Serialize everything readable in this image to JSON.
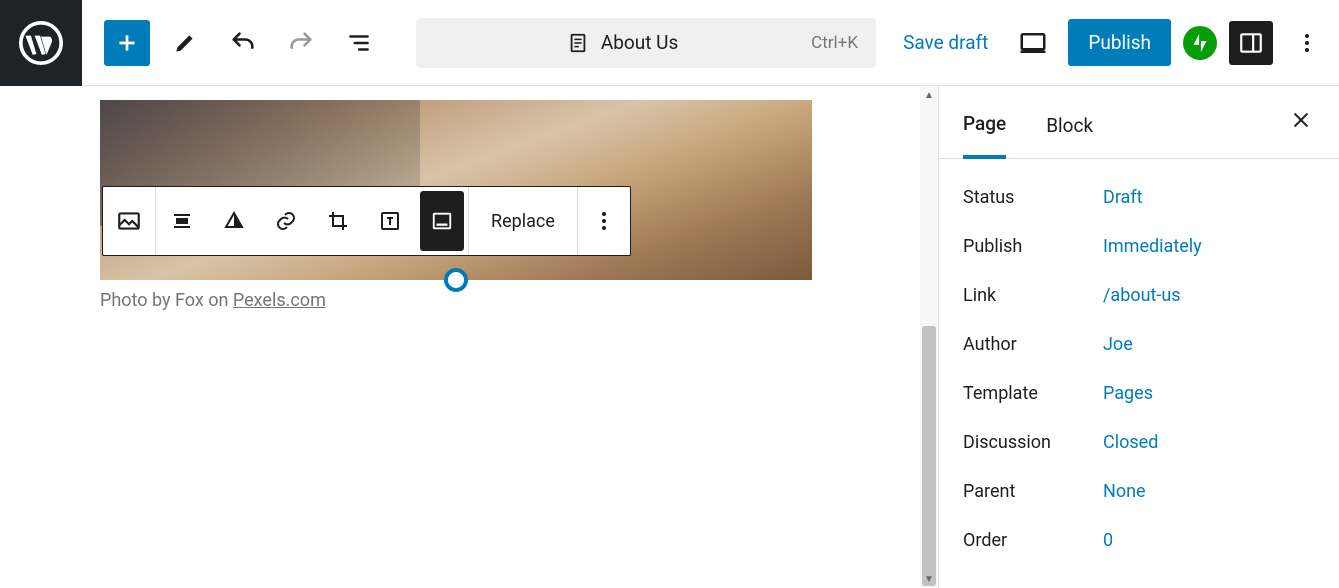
{
  "header": {
    "doc_title": "About Us",
    "shortcut": "Ctrl+K",
    "save_draft": "Save draft",
    "publish": "Publish"
  },
  "block_toolbar": {
    "replace": "Replace",
    "icons": {
      "block": "image-block-icon",
      "align": "align-icon",
      "duotone": "duotone-icon",
      "link": "link-icon",
      "crop": "crop-icon",
      "textoverlay": "text-overlay-icon",
      "caption": "caption-icon"
    }
  },
  "caption": {
    "prefix": "Photo by Fox on ",
    "link_text": "Pexels.com"
  },
  "sidebar": {
    "tabs": {
      "page": "Page",
      "block": "Block"
    },
    "rows": [
      {
        "label": "Status",
        "value": "Draft"
      },
      {
        "label": "Publish",
        "value": "Immediately"
      },
      {
        "label": "Link",
        "value": "/about-us"
      },
      {
        "label": "Author",
        "value": "Joe"
      },
      {
        "label": "Template",
        "value": "Pages"
      },
      {
        "label": "Discussion",
        "value": "Closed"
      },
      {
        "label": "Parent",
        "value": "None"
      },
      {
        "label": "Order",
        "value": "0"
      }
    ]
  }
}
